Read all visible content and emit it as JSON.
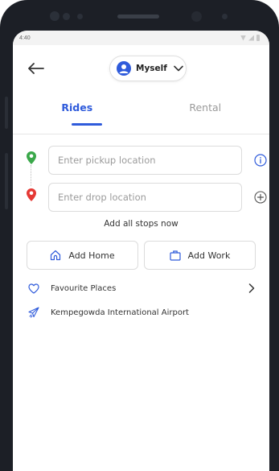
{
  "status_bar": {
    "time": "4:40"
  },
  "header": {
    "profile_label": "Myself"
  },
  "tabs": [
    {
      "label": "Rides",
      "active": true
    },
    {
      "label": "Rental",
      "active": false
    }
  ],
  "locations": {
    "pickup_placeholder": "Enter pickup location",
    "drop_placeholder": "Enter drop location",
    "add_stops_label": "Add all stops now"
  },
  "quick_actions": {
    "home_label": "Add Home",
    "work_label": "Add Work"
  },
  "list": [
    {
      "label": "Favourite Places",
      "icon": "heart-icon"
    },
    {
      "label": "Kempegowda International Airport",
      "icon": "airplane-icon"
    }
  ],
  "colors": {
    "accent": "#2f5bdb",
    "pickup_pin": "#3aa84a",
    "drop_pin": "#e53935"
  }
}
